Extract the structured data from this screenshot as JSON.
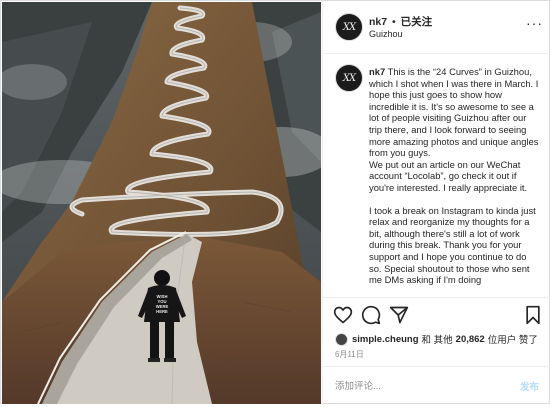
{
  "header": {
    "avatar_text": "XX",
    "username": "nk7",
    "dot": "•",
    "follow_status": "已关注",
    "location": "Guizhou",
    "more": "···"
  },
  "caption": {
    "avatar_text": "XX",
    "username": "nk7",
    "paragraph1": "This is the “24 Curves” in Guizhou, which I shot when I was there in March. I hope this just goes to show how incredible it is. It's so awesome to see a lot of people visiting Guizhou after our trip there, and I look forward to seeing more amazing photos and unique angles from you guys.",
    "paragraph2": "We put out an article on our WeChat account “Locolab”, go check it out if you're interested. I really appreciate it.",
    "paragraph3": "I took a break on Instagram to kinda just relax and reorganize my thoughts for a bit, although there's still a lot of work during this break. Thank you for your support and I hope you continue to do so. Special shoutout to those who sent me DMs asking if I'm doing"
  },
  "photo": {
    "hoodie_text": [
      "WISH",
      "YOU",
      "WERE",
      "HERE"
    ]
  },
  "actions": {
    "icons": [
      "heart-icon",
      "comment-icon",
      "share-icon",
      "bookmark-icon"
    ]
  },
  "likes": {
    "liker": "simple.cheung",
    "connector": "和 其他",
    "count": "20,862",
    "suffix": "位用户 赞了"
  },
  "date": "6月11日",
  "comment": {
    "placeholder": "添加评论...",
    "post_label": "发布"
  },
  "colors": {
    "post_button": "#b2dffc",
    "secondary_text": "#8e8e8e"
  }
}
